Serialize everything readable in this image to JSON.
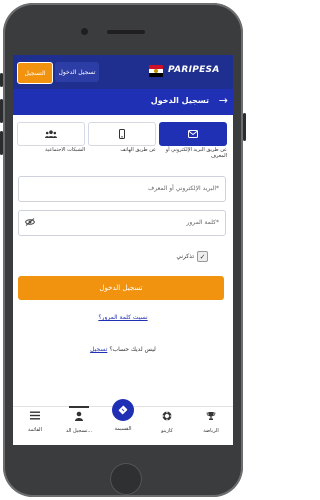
{
  "topbar": {
    "register_label": "التسجيل",
    "login_label": "تسجيل الدخول",
    "logo": "PARIPESA"
  },
  "header": {
    "title": "تسجيل الدخول"
  },
  "tabs": [
    {
      "label": "عن طريق البريد الإلكتروني أو المعرف",
      "icon": "envelope-icon"
    },
    {
      "label": "عن طريق الهاتف",
      "icon": "phone-icon"
    },
    {
      "label": "الشبكات الاجتماعية",
      "icon": "users-icon"
    }
  ],
  "form": {
    "email_placeholder": "البريد الإلكتروني أو المعرف*",
    "password_placeholder": "كلمة المرور*",
    "remember_label": "تذكرني",
    "remember_checked": true,
    "login_button": "تسجيل الدخول",
    "forgot_link": "نسيت كلمة المرور؟",
    "no_account_text": "ليس لديك حساب؟",
    "register_link": "تسجيل"
  },
  "bottom_nav": [
    {
      "label": "الرياضة",
      "icon": "trophy-icon"
    },
    {
      "label": "كازينو",
      "icon": "casino-chip-icon"
    },
    {
      "label": "القسيمة",
      "icon": "coupon-icon"
    },
    {
      "label": "تسجيل الد...",
      "icon": "user-icon"
    },
    {
      "label": "القائمة",
      "icon": "menu-icon"
    }
  ],
  "colors": {
    "brand_blue": "#1f30b5",
    "topbar_blue": "#1e2f8f",
    "accent_orange": "#f29310"
  }
}
